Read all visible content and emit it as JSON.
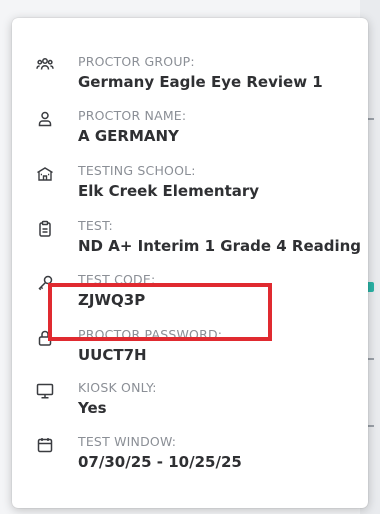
{
  "fields": [
    {
      "icon": "group-icon",
      "label": "PROCTOR GROUP:",
      "value": "Germany Eagle Eye Review 1"
    },
    {
      "icon": "person-icon",
      "label": "PROCTOR NAME:",
      "value": "A GERMANY"
    },
    {
      "icon": "school-icon",
      "label": "TESTING SCHOOL:",
      "value": "Elk Creek Elementary"
    },
    {
      "icon": "clipboard-icon",
      "label": "TEST:",
      "value": "ND A+ Interim 1 Grade 4 Reading"
    },
    {
      "icon": "key-icon",
      "label": "TEST CODE:",
      "value": "ZJWQ3P"
    },
    {
      "icon": "lock-icon",
      "label": "PROCTOR PASSWORD:",
      "value": "UUCT7H"
    },
    {
      "icon": "monitor-icon",
      "label": "KIOSK ONLY:",
      "value": "Yes"
    },
    {
      "icon": "calendar-icon",
      "label": "TEST WINDOW:",
      "value": "07/30/25 - 10/25/25"
    }
  ],
  "colors": {
    "label": "#8b8f96",
    "value": "#2f3033",
    "highlight": "#e02a30",
    "icon": "#3a3c40"
  }
}
